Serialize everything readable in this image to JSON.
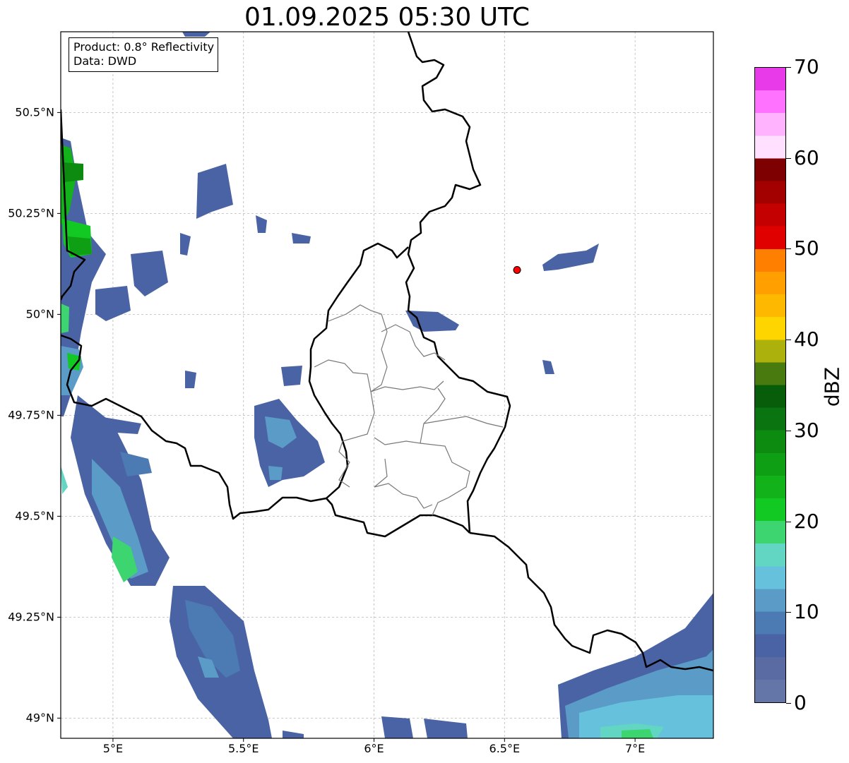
{
  "title": "01.09.2025 05:30 UTC",
  "info": {
    "product": "Product: 0.8° Reflectivity",
    "source": "Data: DWD"
  },
  "map": {
    "lon_range": [
      4.8,
      7.3
    ],
    "lat_range": [
      48.95,
      50.7
    ],
    "x_ticks": [
      {
        "lon": 5.0,
        "label": "5°E"
      },
      {
        "lon": 5.5,
        "label": "5.5°E"
      },
      {
        "lon": 6.0,
        "label": "6°E"
      },
      {
        "lon": 6.5,
        "label": "6.5°E"
      },
      {
        "lon": 7.0,
        "label": "7°E"
      }
    ],
    "y_ticks": [
      {
        "lat": 50.5,
        "label": "50.5°N"
      },
      {
        "lat": 50.25,
        "label": "50.25°N"
      },
      {
        "lat": 50.0,
        "label": "50°N"
      },
      {
        "lat": 49.75,
        "label": "49.75°N"
      },
      {
        "lat": 49.5,
        "label": "49.5°N"
      },
      {
        "lat": 49.25,
        "label": "49.25°N"
      },
      {
        "lat": 49.0,
        "label": "49°N"
      }
    ],
    "radar_site": {
      "lon": 6.548,
      "lat": 50.11,
      "color": "#ff0000"
    }
  },
  "colorbar": {
    "unit": "dBZ",
    "min": 0,
    "max": 70,
    "ticks": [
      {
        "value": 0,
        "label": "0"
      },
      {
        "value": 10,
        "label": "10"
      },
      {
        "value": 20,
        "label": "20"
      },
      {
        "value": 30,
        "label": "30"
      },
      {
        "value": 40,
        "label": "40"
      },
      {
        "value": 50,
        "label": "50"
      },
      {
        "value": 60,
        "label": "60"
      },
      {
        "value": 70,
        "label": "70"
      }
    ],
    "colors": [
      "#6475a8",
      "#5a6ba3",
      "#4a63a4",
      "#4c7bb3",
      "#5a9bc7",
      "#66c1dc",
      "#62d6c2",
      "#3dd56f",
      "#11c922",
      "#12b31a",
      "#0f9f14",
      "#0d8b10",
      "#0a7410",
      "#075d0a",
      "#487a10",
      "#adb10b",
      "#ffd500",
      "#ffb800",
      "#ff9f00",
      "#ff7f00",
      "#e00000",
      "#c40000",
      "#a30000",
      "#7f0000",
      "#ffe1ff",
      "#ffb3ff",
      "#ff72ff",
      "#e83ae8"
    ]
  }
}
